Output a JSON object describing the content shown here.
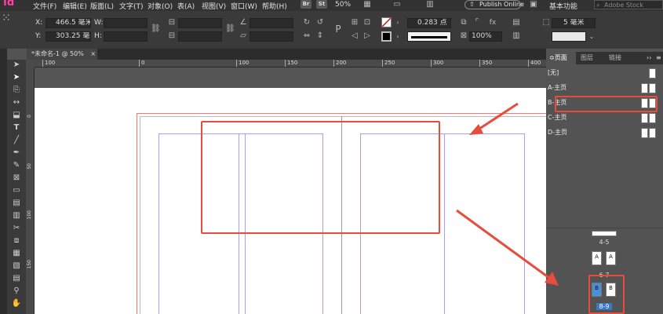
{
  "app": {
    "logo": "Id"
  },
  "menu": [
    "文件(F)",
    "编辑(E)",
    "版面(L)",
    "文字(T)",
    "对象(O)",
    "表(A)",
    "视图(V)",
    "窗口(W)",
    "帮助(H)"
  ],
  "bridge": {
    "br": "Br",
    "st": "St",
    "zoom": "50%"
  },
  "publish": "Publish Online",
  "workspace": "基本功能",
  "search": {
    "placeholder": "Adobe Stock"
  },
  "control": {
    "x_label": "X:",
    "x_value": "466.5 毫米",
    "y_label": "Y:",
    "y_value": "303.25 毫米",
    "w_label": "W:",
    "h_label": "H:",
    "stroke_weight": "0.283 点",
    "opacity": "100%",
    "gap": "5 毫米"
  },
  "document_tab": {
    "title": "*未命名-1 @ 50%",
    "close": "×"
  },
  "ruler": {
    "h_ticks": [
      "100",
      "0",
      "100",
      "150",
      "200",
      "250",
      "300",
      "350",
      "400"
    ],
    "v_ticks": [
      "0",
      "50",
      "100",
      "150"
    ]
  },
  "panel": {
    "tabs": [
      "页面",
      "图层",
      "链接"
    ],
    "menu_icon": "››",
    "masters": [
      "[无]",
      "A-主页",
      "B-主页",
      "C-主页",
      "D-主页"
    ],
    "spreads": [
      {
        "label": "4-5",
        "left": "",
        "right": ""
      },
      {
        "label": "6-7",
        "left": "A",
        "right": "A"
      },
      {
        "label": "8-9",
        "left": "B",
        "right": "B"
      }
    ]
  },
  "colors": {
    "accent_red": "#e84c3d",
    "selected_blue": "#4a90d9",
    "logo_pink": "#ff3fa3"
  }
}
